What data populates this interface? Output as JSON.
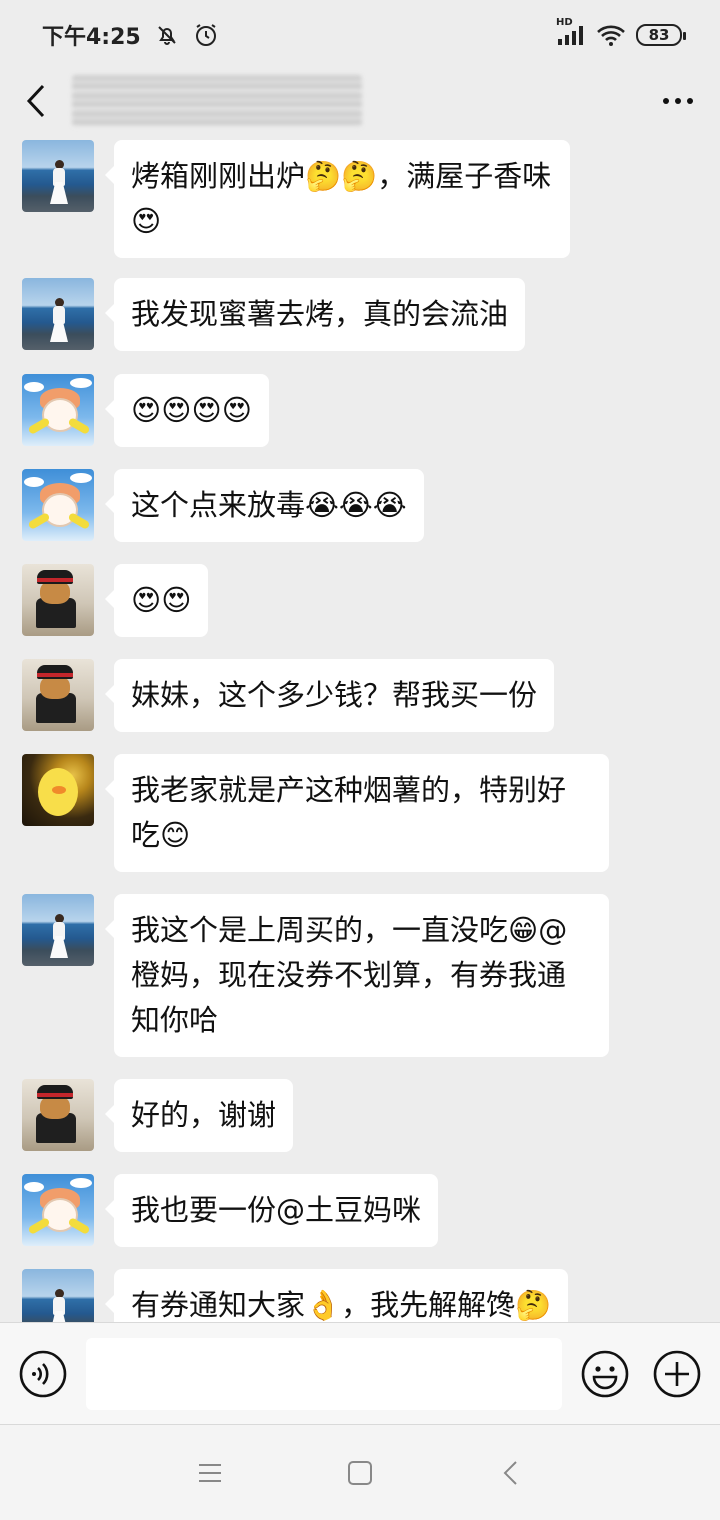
{
  "status_bar": {
    "time": "下午4:25",
    "battery": "83",
    "network": "HD",
    "icons": [
      "mute-icon",
      "alarm-icon",
      "signal-icon",
      "wifi-icon",
      "battery-icon"
    ]
  },
  "header": {
    "back_icon": "chevron-left-icon",
    "more_icon": "more-dots-icon"
  },
  "messages": [
    {
      "avatar": "lake",
      "text": "烤箱刚刚出炉🤔🤔，满屋子香味😍"
    },
    {
      "avatar": "lake",
      "text": "我发现蜜薯去烤，真的会流油"
    },
    {
      "avatar": "cartoon",
      "text": "😍😍😍😍"
    },
    {
      "avatar": "cartoon",
      "text": "这个点来放毒😭😭😭"
    },
    {
      "avatar": "dog",
      "text": "😍😍"
    },
    {
      "avatar": "dog",
      "text": "妹妹，这个多少钱？帮我买一份"
    },
    {
      "avatar": "duck",
      "text": "我老家就是产这种烟薯的，特别好吃😊"
    },
    {
      "avatar": "lake",
      "text": "我这个是上周买的，一直没吃😁@橙妈，现在没券不划算，有券我通知你哈"
    },
    {
      "avatar": "dog",
      "text": "好的，谢谢"
    },
    {
      "avatar": "cartoon",
      "text": "我也要一份@土豆妈咪"
    },
    {
      "avatar": "lake",
      "text": "有券通知大家👌，我先解解馋🤔"
    }
  ],
  "input": {
    "value": "",
    "voice_icon": "voice-icon",
    "emoji_icon": "emoji-icon",
    "plus_icon": "plus-icon"
  },
  "nav": {
    "icons": [
      "menu-icon",
      "home-icon",
      "back-icon"
    ]
  }
}
